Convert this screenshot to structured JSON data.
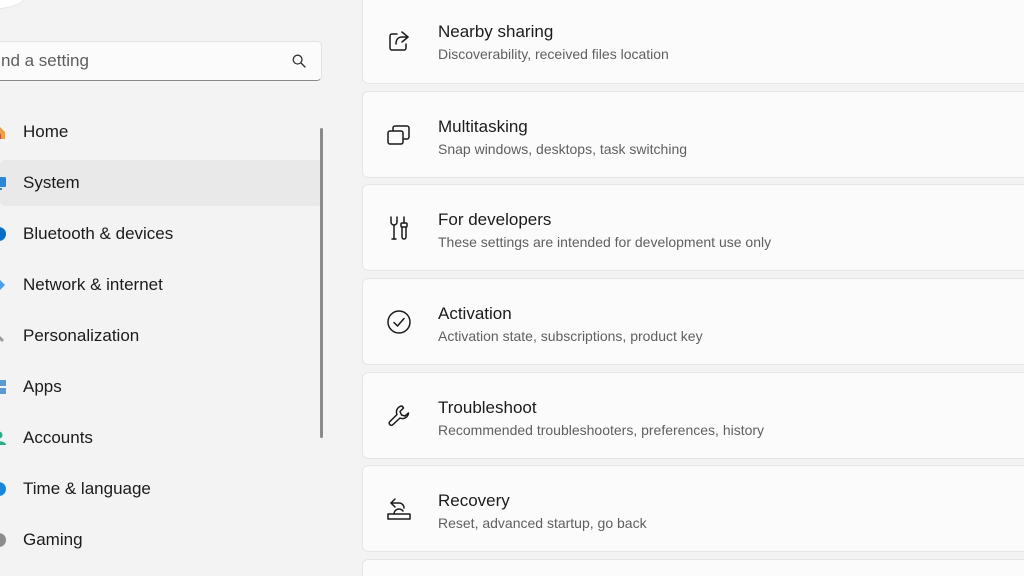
{
  "search": {
    "placeholder": "nd a setting"
  },
  "nav": {
    "items": [
      {
        "label": "Home",
        "icon": "home-icon"
      },
      {
        "label": "System",
        "icon": "system-icon",
        "selected": true
      },
      {
        "label": "Bluetooth & devices",
        "icon": "bluetooth-icon"
      },
      {
        "label": "Network & internet",
        "icon": "network-icon"
      },
      {
        "label": "Personalization",
        "icon": "brush-icon"
      },
      {
        "label": "Apps",
        "icon": "apps-icon"
      },
      {
        "label": "Accounts",
        "icon": "accounts-icon"
      },
      {
        "label": "Time & language",
        "icon": "globe-icon"
      },
      {
        "label": "Gaming",
        "icon": "gaming-icon"
      }
    ]
  },
  "cards": [
    {
      "title": "Nearby sharing",
      "subtitle": "Discoverability, received files location",
      "icon": "share-icon"
    },
    {
      "title": "Multitasking",
      "subtitle": "Snap windows, desktops, task switching",
      "icon": "multitasking-icon"
    },
    {
      "title": "For developers",
      "subtitle": "These settings are intended for development use only",
      "icon": "developer-tools-icon"
    },
    {
      "title": "Activation",
      "subtitle": "Activation state, subscriptions, product key",
      "icon": "check-circle-icon"
    },
    {
      "title": "Troubleshoot",
      "subtitle": "Recommended troubleshooters, preferences, history",
      "icon": "wrench-icon"
    },
    {
      "title": "Recovery",
      "subtitle": "Reset, advanced startup, go back",
      "icon": "recovery-icon"
    }
  ],
  "colors": {
    "background": "#f3f3f3",
    "card": "#fbfbfb",
    "selected": "#e9e9e9",
    "accent": "#0067c0"
  }
}
